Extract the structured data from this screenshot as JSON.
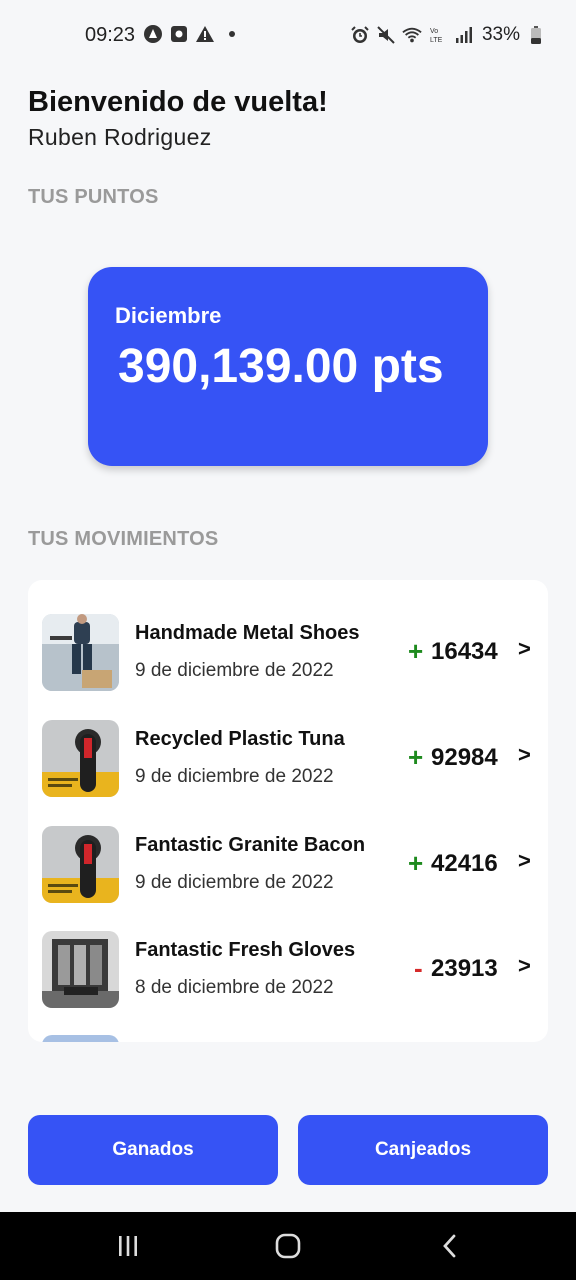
{
  "status_bar": {
    "time": "09:23",
    "battery": "33%"
  },
  "header": {
    "greeting": "Bienvenido de vuelta!",
    "user_name": "Ruben Rodriguez"
  },
  "points": {
    "section_label": "TUS PUNTOS",
    "month": "Diciembre",
    "value": "390,139.00 pts",
    "card_color": "#3653f5"
  },
  "movements": {
    "section_label": "TUS MOVIMIENTOS",
    "items": [
      {
        "name": "Handmade Metal Shoes",
        "date": "9 de diciembre de 2022",
        "sign": "+",
        "amount": "16434",
        "image": "warehouse-worker-photo"
      },
      {
        "name": "Recycled Plastic Tuna",
        "date": "9 de diciembre de 2022",
        "sign": "+",
        "amount": "92984",
        "image": "switch-handle-photo"
      },
      {
        "name": "Fantastic Granite Bacon",
        "date": "9 de diciembre de 2022",
        "sign": "+",
        "amount": "42416",
        "image": "switch-handle-photo"
      },
      {
        "name": "Fantastic Fresh Gloves",
        "date": "8 de diciembre de 2022",
        "sign": "-",
        "amount": "23913",
        "image": "industrial-machine-photo"
      }
    ]
  },
  "buttons": {
    "earned": "Ganados",
    "redeemed": "Canjeados"
  },
  "colors": {
    "accent": "#3653f5",
    "positive": "#1e8a1e",
    "negative": "#d62a2a"
  }
}
